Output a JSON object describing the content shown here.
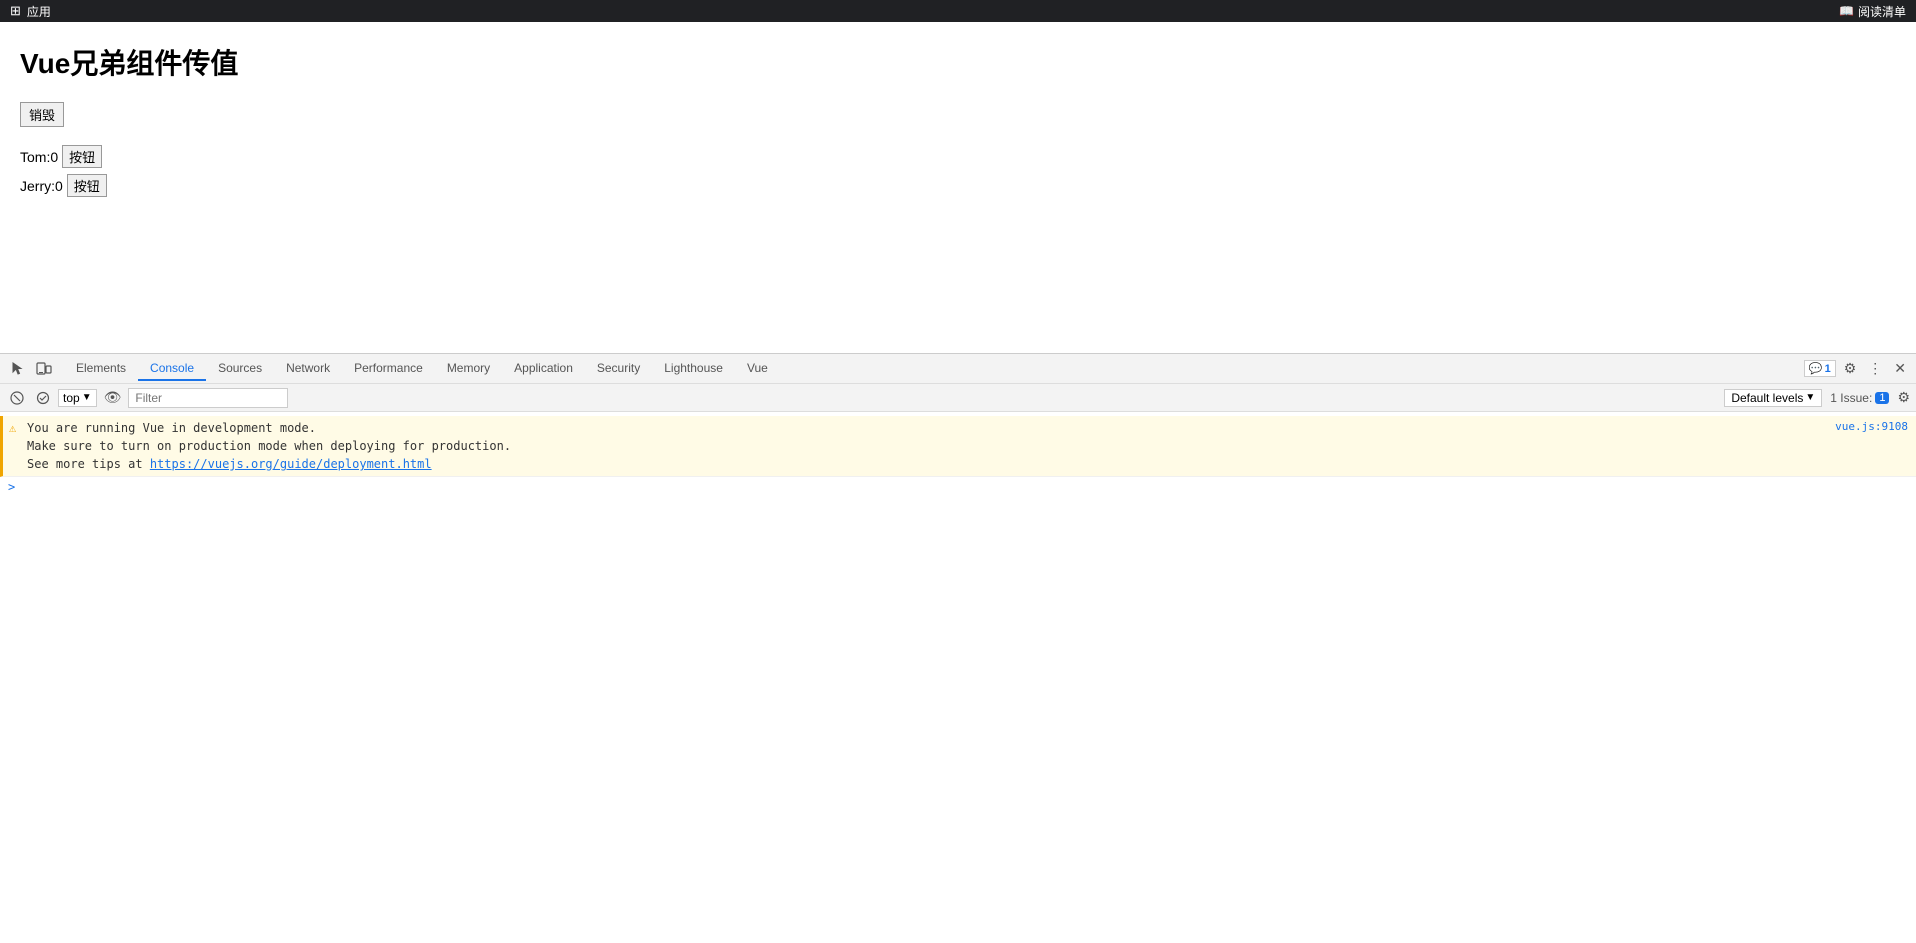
{
  "topbar": {
    "app_label": "应用",
    "reader_label": "阅读清单"
  },
  "page": {
    "title": "Vue兄弟组件传值",
    "destroy_btn": "销毁",
    "tom_label": "Tom:0",
    "tom_btn": "按钮",
    "jerry_label": "Jerry:0",
    "jerry_btn": "按钮"
  },
  "devtools": {
    "tabs": [
      {
        "label": "Elements",
        "active": false
      },
      {
        "label": "Console",
        "active": true
      },
      {
        "label": "Sources",
        "active": false
      },
      {
        "label": "Network",
        "active": false
      },
      {
        "label": "Performance",
        "active": false
      },
      {
        "label": "Memory",
        "active": false
      },
      {
        "label": "Application",
        "active": false
      },
      {
        "label": "Security",
        "active": false
      },
      {
        "label": "Lighthouse",
        "active": false
      },
      {
        "label": "Vue",
        "active": false
      }
    ],
    "console_toolbar": {
      "top_label": "top",
      "filter_placeholder": "Filter",
      "default_levels": "Default levels",
      "issue_text": "1 Issue:",
      "issue_count": "1"
    },
    "messages": [
      {
        "text": "You are running Vue in development mode.\nMake sure to turn on production mode when deploying for production.\nSee more tips at ",
        "link": "https://vuejs.org/guide/deployment.html",
        "source": "vue.js:9108",
        "type": "warn"
      }
    ],
    "prompt": ">"
  }
}
